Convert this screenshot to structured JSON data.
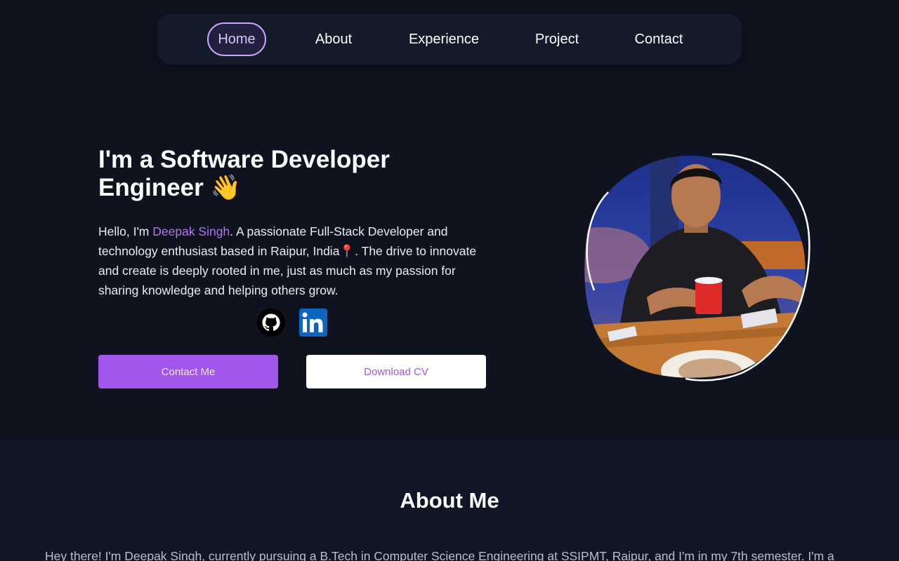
{
  "nav": {
    "items": [
      {
        "label": "Home"
      },
      {
        "label": "About"
      },
      {
        "label": "Experience"
      },
      {
        "label": "Project"
      },
      {
        "label": "Contact"
      }
    ],
    "active": "Home"
  },
  "hero": {
    "title": "I'm a Software Developer Engineer 👋",
    "intro_prefix": "Hello, I'm ",
    "name": "Deepak Singh",
    "intro_rest": ". A passionate Full-Stack Developer and technology enthusiast based in Raipur, India📍. The drive to innovate and create is deeply rooted in me, just as much as my passion for sharing knowledge and helping others grow.",
    "social": [
      {
        "name": "github",
        "icon": "github-icon"
      },
      {
        "name": "linkedin",
        "icon": "linkedin-icon"
      }
    ],
    "contact_button": "Contact Me",
    "download_button": "Download CV"
  },
  "about": {
    "title": "About Me",
    "text": "Hey there! I'm Deepak Singh, currently pursuing a B.Tech in Computer Science Engineering at SSIPMT, Raipur, and I'm in my 7th semester. I'm a"
  },
  "colors": {
    "background": "#0f1320",
    "nav_bg": "#131a2a",
    "accent": "#a256ec",
    "accent_light": "#c7a5f7"
  }
}
